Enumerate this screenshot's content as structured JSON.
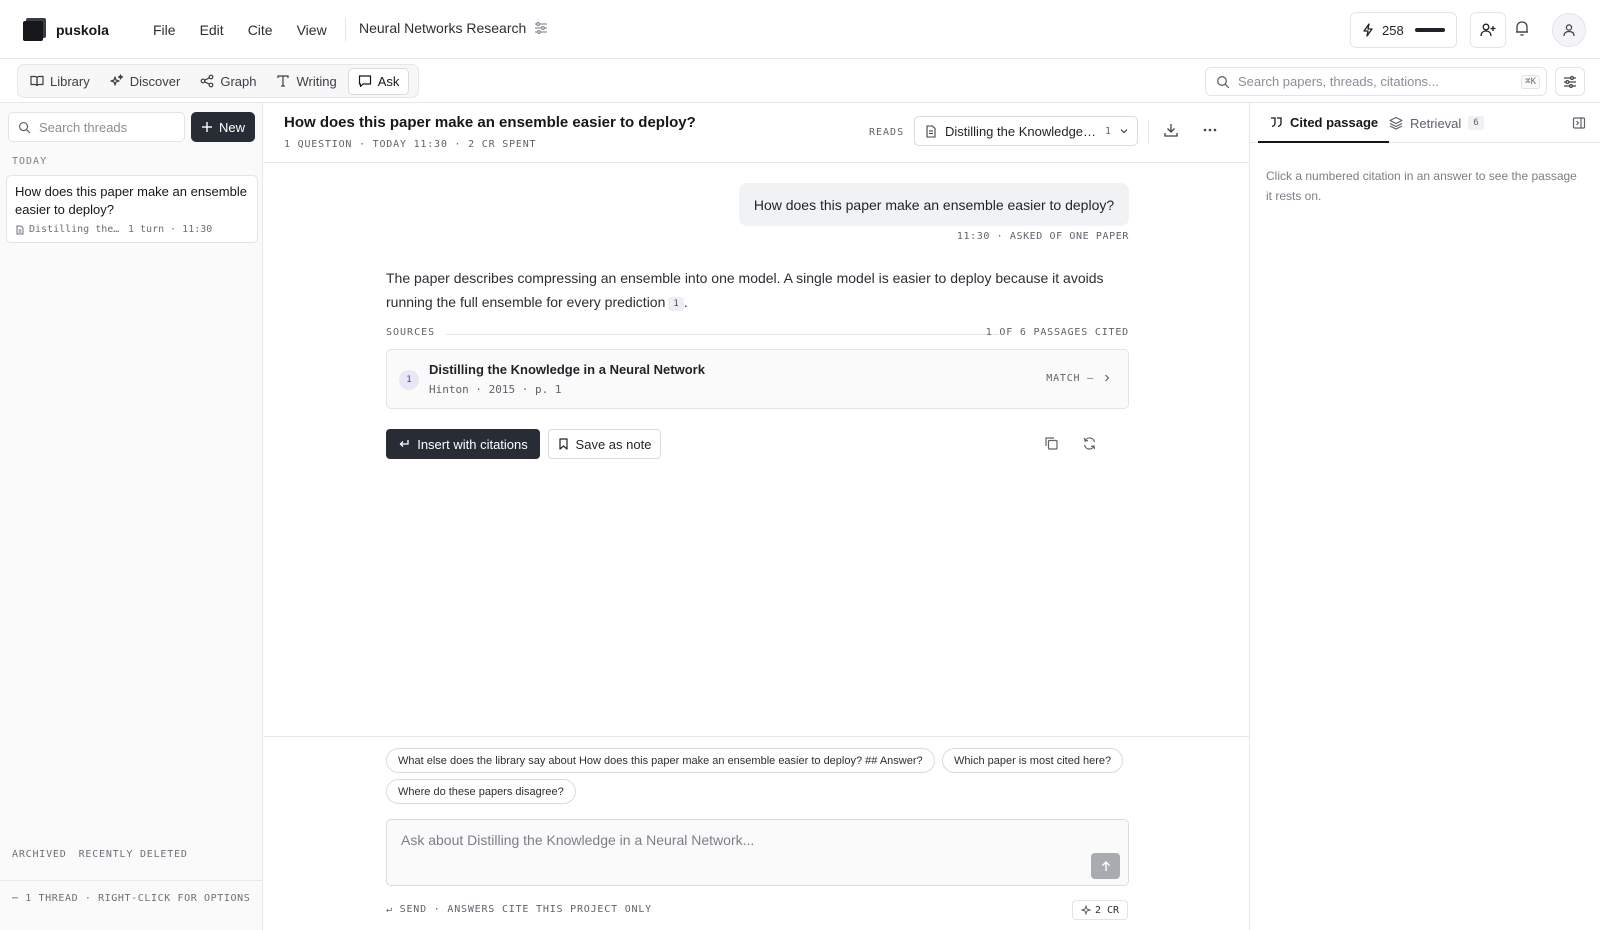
{
  "app": {
    "brand": "puskola",
    "project_title": "Neural Networks Research"
  },
  "menu": [
    "File",
    "Edit",
    "Cite",
    "View"
  ],
  "credits": {
    "balance": "258"
  },
  "nav": {
    "tabs": [
      {
        "label": "Library",
        "icon": "book-icon"
      },
      {
        "label": "Discover",
        "icon": "sparkles-icon"
      },
      {
        "label": "Graph",
        "icon": "share-graph-icon"
      },
      {
        "label": "Writing",
        "icon": "type-icon"
      },
      {
        "label": "Ask",
        "icon": "chat-bubble-icon",
        "active": true
      }
    ],
    "search": {
      "placeholder": "Search papers, threads, citations...",
      "shortcut": "⌘K"
    }
  },
  "sidebar": {
    "search_placeholder": "Search threads",
    "new_label": "New",
    "section_today": "TODAY",
    "threads": [
      {
        "title": "How does this paper make an ensemble easier to deploy?",
        "source": "Distilling the…",
        "meta": "1 turn · 11:30"
      }
    ],
    "archived": "ARCHIVED",
    "recently_deleted": "RECENTLY DELETED",
    "footer": "⋯ 1 THREAD · RIGHT-CLICK FOR OPTIONS"
  },
  "thread": {
    "title": "How does this paper make an ensemble easier to deploy?",
    "subtitle": "1 QUESTION · TODAY 11:30 · 2 CR SPENT",
    "reads_label": "READS",
    "reads_value": "Distilling the Knowledge in a Neural Network",
    "reads_count": "1",
    "question": "How does this paper make an ensemble easier to deploy?",
    "question_meta": "11:30 · ASKED OF ONE PAPER",
    "answer_text": "The paper describes compressing an ensemble into one model. A single model is easier to deploy because it avoids running the full ensemble for every prediction",
    "answer_cite": "1",
    "answer_end": ".",
    "sources_label": "SOURCES",
    "sources_count": "1 OF 6 PASSAGES CITED",
    "sources": [
      {
        "num": "1",
        "title": "Distilling the Knowledge in a Neural Network",
        "meta": "Hinton · 2015 · p. 1",
        "match": "MATCH —"
      }
    ],
    "insert_label": "Insert with citations",
    "save_label": "Save as note"
  },
  "composer": {
    "suggestions": [
      "What else does the library say about How does this paper make an ensemble easier to deploy? ## Answer?",
      "Which paper is most cited here?",
      "Where do these papers disagree?"
    ],
    "placeholder": "Ask about Distilling the Knowledge in a Neural Network...",
    "hint": "↵ SEND · ANSWERS CITE THIS PROJECT ONLY",
    "cost": "2 CR"
  },
  "right_panel": {
    "tabs": [
      {
        "label": "Cited passage",
        "active": true
      },
      {
        "label": "Retrieval",
        "badge": "6"
      }
    ],
    "placeholder": "Click a numbered citation in an answer to see the passage it rests on."
  }
}
